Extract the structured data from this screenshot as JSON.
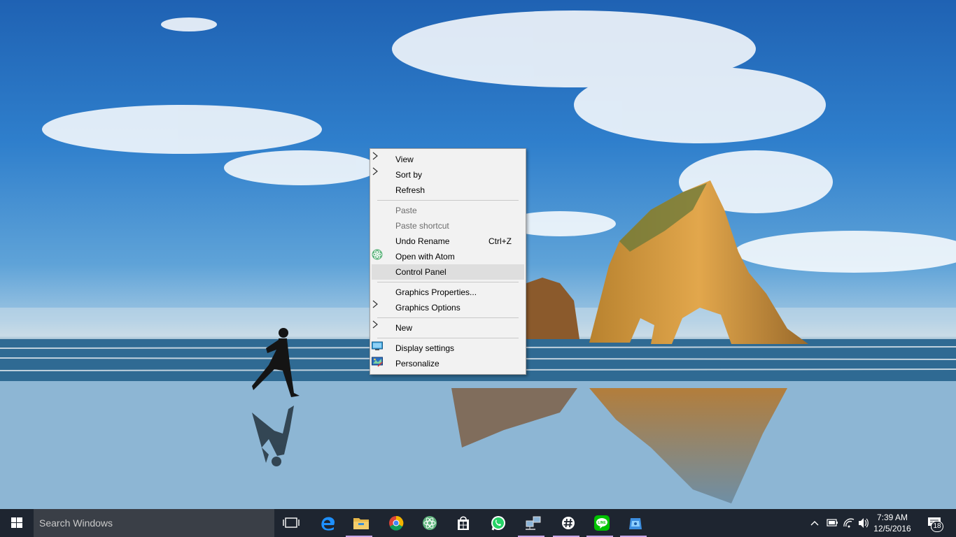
{
  "context_menu": {
    "items": [
      {
        "label": "View",
        "submenu": true
      },
      {
        "label": "Sort by",
        "submenu": true
      },
      {
        "label": "Refresh"
      },
      {
        "separator": true
      },
      {
        "label": "Paste",
        "disabled": true
      },
      {
        "label": "Paste shortcut",
        "disabled": true
      },
      {
        "label": "Undo Rename",
        "shortcut": "Ctrl+Z"
      },
      {
        "label": "Open with Atom",
        "icon": "atom-icon"
      },
      {
        "label": "Control Panel",
        "highlighted": true
      },
      {
        "separator": true
      },
      {
        "label": "Graphics Properties..."
      },
      {
        "label": "Graphics Options",
        "submenu": true
      },
      {
        "separator": true
      },
      {
        "label": "New",
        "submenu": true
      },
      {
        "separator": true
      },
      {
        "label": "Display settings",
        "icon": "display-icon"
      },
      {
        "label": "Personalize",
        "icon": "personalize-icon"
      }
    ]
  },
  "taskbar": {
    "search_placeholder": "Search Windows",
    "pinned_apps": [
      {
        "name": "edge-icon",
        "running": false
      },
      {
        "name": "file-explorer-icon",
        "running": true
      },
      {
        "name": "chrome-icon",
        "running": false
      },
      {
        "name": "atom-icon",
        "running": false
      },
      {
        "name": "store-icon",
        "running": false
      },
      {
        "name": "whatsapp-icon",
        "running": false
      },
      {
        "name": "network-app-icon",
        "running": true
      },
      {
        "name": "hash-app-icon",
        "running": true
      },
      {
        "name": "line-icon",
        "running": true
      },
      {
        "name": "blue-app-icon",
        "running": true
      }
    ],
    "clock": {
      "time": "7:39 AM",
      "date": "12/5/2016"
    },
    "notification_count": "18"
  },
  "colors": {
    "menu_bg": "#f2f2f2",
    "menu_highlight": "#dedede",
    "taskbar_bg": "#1e2530",
    "running_indicator": "#c7a7e8"
  }
}
